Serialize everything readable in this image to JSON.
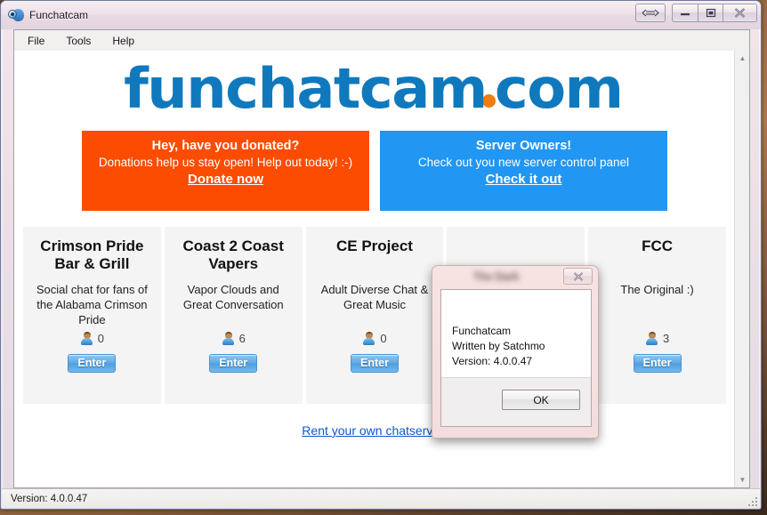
{
  "window": {
    "title": "Funchatcam",
    "icon": "webcam-icon",
    "controls": {
      "resize": "resize-arrows-icon",
      "minimize": "minimize-icon",
      "maximize": "maximize-icon",
      "close": "close-icon"
    }
  },
  "menu": {
    "items": [
      {
        "label": "File"
      },
      {
        "label": "Tools"
      },
      {
        "label": "Help"
      }
    ]
  },
  "page": {
    "logo": {
      "before_dot": "funchatcam",
      "after_dot": "com",
      "color": "#1079bd",
      "dot_color": "#f07c12"
    },
    "banners": [
      {
        "style": "orange",
        "color": "#fc4c02",
        "heading": "Hey, have you donated?",
        "subtext": "Donations help us stay open! Help out today! :-)",
        "link": "Donate now"
      },
      {
        "style": "blue",
        "color": "#2196f3",
        "heading": "Server Owners!",
        "subtext": "Check out you new server control panel",
        "link": "Check it out"
      }
    ],
    "cards": [
      {
        "title": "Crimson Pride Bar & Grill",
        "description": "Social chat for fans of the Alabama Crimson Pride",
        "users": "0",
        "button": "Enter"
      },
      {
        "title": "Coast 2 Coast Vapers",
        "description": "Vapor Clouds and Great Conversation",
        "users": "6",
        "button": "Enter"
      },
      {
        "title": "CE Project",
        "description": "Adult Diverse Chat & Great Music",
        "users": "0",
        "button": "Enter"
      },
      {
        "title": "",
        "description": "",
        "users": "",
        "button": ""
      },
      {
        "title": "FCC",
        "description": "The Original :)",
        "users": "3",
        "button": "Enter"
      }
    ],
    "rent_link": "Rent your own chatserver!"
  },
  "status_bar": {
    "version_text": "Version: 4.0.0.47"
  },
  "about_dialog": {
    "title": "The Dark",
    "close_icon": "close-icon",
    "lines": "Funchatcam\nWritten by Satchmo\nVersion: 4.0.0.47",
    "ok_label": "OK"
  }
}
